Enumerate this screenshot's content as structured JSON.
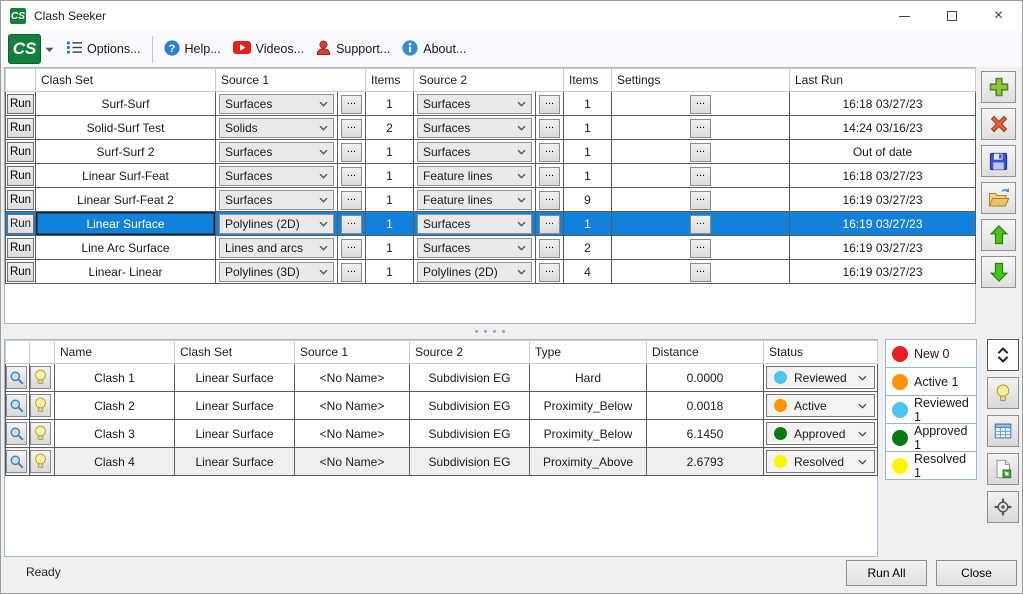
{
  "window": {
    "title": "Clash Seeker"
  },
  "titlebar": {
    "close_glyph": "×"
  },
  "toolbar": {
    "logo_text": "CS",
    "options": "Options...",
    "help": "Help...",
    "videos": "Videos...",
    "support": "Support...",
    "about": "About..."
  },
  "clash_sets": {
    "columns": [
      "",
      "Clash Set",
      "Source 1",
      "Items",
      "Source 2",
      "Items",
      "Settings",
      "Last Run"
    ],
    "run_label": "Run",
    "browse_label": "...",
    "rows": [
      {
        "name": "Surf-Surf",
        "source1": "Surfaces",
        "items1": "1",
        "source2": "Surfaces",
        "items2": "1",
        "last_run": "16:18 03/27/23",
        "selected": false
      },
      {
        "name": "Solid-Surf Test",
        "source1": "Solids",
        "items1": "2",
        "source2": "Surfaces",
        "items2": "1",
        "last_run": "14:24 03/16/23",
        "selected": false
      },
      {
        "name": "Surf-Surf 2",
        "source1": "Surfaces",
        "items1": "1",
        "source2": "Surfaces",
        "items2": "1",
        "last_run": "Out of date",
        "selected": false
      },
      {
        "name": "Linear Surf-Feat",
        "source1": "Surfaces",
        "items1": "1",
        "source2": "Feature lines",
        "items2": "1",
        "last_run": "16:18 03/27/23",
        "selected": false
      },
      {
        "name": "Linear Surf-Feat 2",
        "source1": "Surfaces",
        "items1": "1",
        "source2": "Feature lines",
        "items2": "9",
        "last_run": "16:19 03/27/23",
        "selected": false
      },
      {
        "name": "Linear Surface",
        "source1": "Polylines (2D)",
        "items1": "1",
        "source2": "Surfaces",
        "items2": "1",
        "last_run": "16:19 03/27/23",
        "selected": true
      },
      {
        "name": "Line Arc Surface",
        "source1": "Lines and arcs",
        "items1": "1",
        "source2": "Surfaces",
        "items2": "2",
        "last_run": "16:19 03/27/23",
        "selected": false
      },
      {
        "name": "Linear- Linear",
        "source1": "Polylines (3D)",
        "items1": "1",
        "source2": "Polylines (2D)",
        "items2": "4",
        "last_run": "16:19 03/27/23",
        "selected": false
      }
    ]
  },
  "results": {
    "columns": [
      "",
      "",
      "Name",
      "Clash Set",
      "Source 1",
      "Source 2",
      "Type",
      "Distance",
      "Status"
    ],
    "rows": [
      {
        "name": "Clash 1",
        "clash_set": "Linear Surface",
        "source1": "<No Name>",
        "source2": "Subdivision EG",
        "type": "Hard",
        "distance": "0.0000",
        "status": "Reviewed",
        "status_color": "#4dc3f0"
      },
      {
        "name": "Clash 2",
        "clash_set": "Linear Surface",
        "source1": "<No Name>",
        "source2": "Subdivision EG",
        "type": "Proximity_Below",
        "distance": "0.0018",
        "status": "Active",
        "status_color": "#ff9300"
      },
      {
        "name": "Clash 3",
        "clash_set": "Linear Surface",
        "source1": "<No Name>",
        "source2": "Subdivision EG",
        "type": "Proximity_Below",
        "distance": "6.1450",
        "status": "Approved",
        "status_color": "#0b7a12"
      },
      {
        "name": "Clash 4",
        "clash_set": "Linear Surface",
        "source1": "<No Name>",
        "source2": "Subdivision EG",
        "type": "Proximity_Above",
        "distance": "2.6793",
        "status": "Resolved",
        "status_color": "#fdf500"
      }
    ]
  },
  "legend": {
    "items": [
      {
        "label": "New 0",
        "color": "#ee1c25"
      },
      {
        "label": "Active 1",
        "color": "#ff9300"
      },
      {
        "label": "Reviewed 1",
        "color": "#4dc3f0"
      },
      {
        "label": "Approved 1",
        "color": "#0b7a12"
      },
      {
        "label": "Resolved 1",
        "color": "#fdf500"
      }
    ]
  },
  "statusbar": {
    "status": "Ready",
    "run_all": "Run All",
    "close": "Close"
  }
}
